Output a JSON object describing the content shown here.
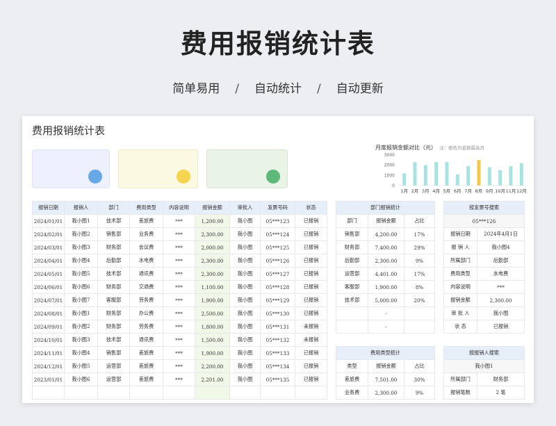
{
  "hero": {
    "title": "费用报销统计表",
    "subtitle_parts": [
      "简单易用",
      "/",
      "自动统计",
      "/",
      "自动更新"
    ]
  },
  "sheet": {
    "title": "费用报销统计表"
  },
  "colors": {
    "card1": "#eef1fd",
    "card1_dot": "#67a8e6",
    "card2": "#fbf9e1",
    "card2_dot": "#f6d44f",
    "card3": "#e9f4e6",
    "card3_dot": "#5cb97a",
    "bar": "#a8e3e2",
    "bar_highlight": "#f3c94b",
    "header_bg": "#e6eef9"
  },
  "chart_data": {
    "type": "bar",
    "title": "月度报销金额对比（元）",
    "note": "注：橙色为金额最高月",
    "categories": [
      "1月",
      "2月",
      "3月",
      "4月",
      "5月",
      "6月",
      "7月",
      "8月",
      "9月",
      "10月",
      "11月",
      "12月"
    ],
    "values": [
      1200,
      2300,
      2000,
      2300,
      2300,
      1100,
      1900,
      2500,
      1800,
      1500,
      1900,
      2200
    ],
    "highlight_index": 7,
    "yticks": [
      0,
      1000,
      2000,
      3000
    ],
    "ylim": [
      0,
      3000
    ]
  },
  "main_table": {
    "headers": [
      "报销日期",
      "报销人",
      "部门",
      "费用类型",
      "内容说明",
      "报销金额",
      "审批人",
      "发票号码",
      "状态"
    ],
    "rows": [
      [
        "2024/01/01",
        "我小图1",
        "技术部",
        "差旅费",
        "***",
        "1,200.00",
        "我小图",
        "05***123",
        "已报销"
      ],
      [
        "2024/02/01",
        "我小图2",
        "销售部",
        "业务费",
        "***",
        "2,300.00",
        "我小图",
        "05***124",
        "已报销"
      ],
      [
        "2024/03/01",
        "我小图3",
        "财务部",
        "会议费",
        "***",
        "2,000.00",
        "我小图",
        "05***125",
        "已报销"
      ],
      [
        "2024/04/01",
        "我小图4",
        "后勤部",
        "水电费",
        "***",
        "2,300.00",
        "我小图",
        "05***126",
        "已报销"
      ],
      [
        "2024/05/01",
        "我小图5",
        "技术部",
        "通讯费",
        "***",
        "2,300.00",
        "我小图",
        "05***127",
        "已报销"
      ],
      [
        "2024/06/01",
        "我小图6",
        "财务部",
        "交通费",
        "***",
        "1,100.00",
        "我小图",
        "05***128",
        "已报销"
      ],
      [
        "2024/07/01",
        "我小图7",
        "客服部",
        "劳务费",
        "***",
        "1,900.00",
        "我小图",
        "05***129",
        "已报销"
      ],
      [
        "2024/08/01",
        "我小图1",
        "财务部",
        "办公费",
        "***",
        "2,500.00",
        "我小图",
        "05***130",
        "已报销"
      ],
      [
        "2024/09/01",
        "我小图2",
        "财务部",
        "劳务费",
        "***",
        "1,800.00",
        "我小图",
        "05***131",
        "未报销"
      ],
      [
        "2024/10/01",
        "我小图3",
        "技术部",
        "通讯费",
        "***",
        "1,500.00",
        "我小图",
        "05***132",
        "未报销"
      ],
      [
        "2024/11/01",
        "我小图4",
        "销售部",
        "差旅费",
        "***",
        "1,900.00",
        "我小图",
        "05***133",
        "已报销"
      ],
      [
        "2024/12/01",
        "我小图5",
        "运营部",
        "差旅费",
        "***",
        "2,200.00",
        "我小图",
        "05***134",
        "已报销"
      ],
      [
        "2023/01/01",
        "我小图6",
        "运营部",
        "差旅费",
        "***",
        "2,201.00",
        "我小图",
        "05***135",
        "已报销"
      ],
      [
        "",
        "",
        "",
        "",
        "",
        "",
        "",
        "",
        ""
      ]
    ]
  },
  "dept_table": {
    "title": "部门报销统计",
    "headers": [
      "部门",
      "报销金额",
      "占比"
    ],
    "rows": [
      [
        "销售部",
        "4,200.00",
        "17%"
      ],
      [
        "财务部",
        "7,400.00",
        "29%"
      ],
      [
        "后勤部",
        "2,300.00",
        "9%"
      ],
      [
        "运营部",
        "4,401.00",
        "17%"
      ],
      [
        "客服部",
        "1,900.00",
        "8%"
      ],
      [
        "技术部",
        "5,000.00",
        "20%"
      ],
      [
        "",
        "-",
        ""
      ],
      [
        "",
        "-",
        ""
      ]
    ]
  },
  "ticket_table": {
    "title": "按发票号搜索",
    "query": "05***126",
    "rows": [
      [
        "报销日期",
        "2024年4月1日"
      ],
      [
        "报 销 人",
        "我小图4"
      ],
      [
        "所属部门",
        "后勤部"
      ],
      [
        "费用类型",
        "水电费"
      ],
      [
        "内容说明",
        "***"
      ],
      [
        "报销金额",
        "2,300.00"
      ],
      [
        "审 批 人",
        "我小图"
      ],
      [
        "状    态",
        "已报销"
      ]
    ]
  },
  "type_table": {
    "title": "费用类型统计",
    "headers": [
      "类型",
      "报销金额",
      "占比"
    ],
    "rows": [
      [
        "差旅费",
        "7,501.00",
        "30%"
      ],
      [
        "业务费",
        "2,300.00",
        "9%"
      ]
    ]
  },
  "person_table": {
    "title": "按报销人搜索",
    "query": "我小图1",
    "rows": [
      [
        "所属部门",
        "财务部"
      ],
      [
        "报销笔数",
        "2 笔"
      ]
    ]
  }
}
